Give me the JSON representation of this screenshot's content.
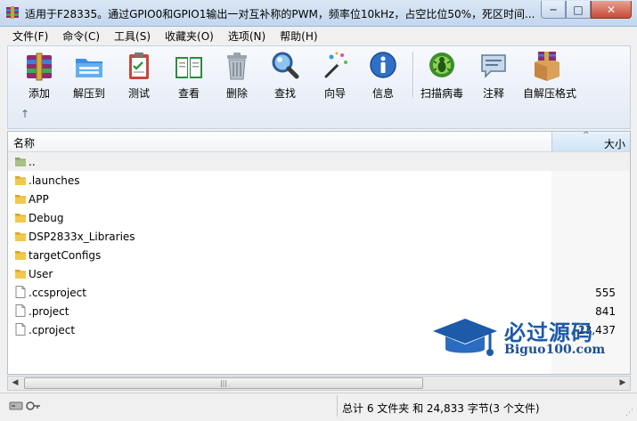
{
  "window": {
    "title": "适用于F28335。通过GPIO0和GPIO1输出一对互补称的PWM，频率位10kHz，占空比位50%，死区时间...",
    "controls": {
      "minimize": "─",
      "maximize": "□",
      "close": "✕"
    }
  },
  "menu": [
    {
      "label": "文件(F)"
    },
    {
      "label": "命令(C)"
    },
    {
      "label": "工具(S)"
    },
    {
      "label": "收藏夹(O)"
    },
    {
      "label": "选项(N)"
    },
    {
      "label": "帮助(H)"
    }
  ],
  "toolbar": {
    "add": "添加",
    "extract": "解压到",
    "test": "测试",
    "view": "查看",
    "delete": "删除",
    "find": "查找",
    "wizard": "向导",
    "info": "信息",
    "virus_scan": "扫描病毒",
    "comment": "注释",
    "sfx": "自解压格式",
    "up_arrow": "↑"
  },
  "list": {
    "columns": {
      "name": "名称",
      "size": "大小",
      "sort_arrow": "^"
    },
    "rows": [
      {
        "name": "..",
        "size": "",
        "icon": "parent-folder-icon"
      },
      {
        "name": ".launches",
        "size": "",
        "icon": "folder-icon"
      },
      {
        "name": "APP",
        "size": "",
        "icon": "folder-icon"
      },
      {
        "name": "Debug",
        "size": "",
        "icon": "folder-icon"
      },
      {
        "name": "DSP2833x_Libraries",
        "size": "",
        "icon": "folder-icon"
      },
      {
        "name": "targetConfigs",
        "size": "",
        "icon": "folder-icon"
      },
      {
        "name": "User",
        "size": "",
        "icon": "folder-icon"
      },
      {
        "name": ".ccsproject",
        "size": "555",
        "icon": "file-icon"
      },
      {
        "name": ".project",
        "size": "841",
        "icon": "file-icon"
      },
      {
        "name": ".cproject",
        "size": "23,437",
        "icon": "file-icon"
      }
    ]
  },
  "watermark": {
    "title": "必过源码",
    "url": "Biguo100.com"
  },
  "scrollbar": {
    "left": "◀",
    "right": "▶",
    "grip": "|||"
  },
  "status": {
    "summary": "总计 6 文件夹 和 24,833 字节(3 个文件)"
  }
}
